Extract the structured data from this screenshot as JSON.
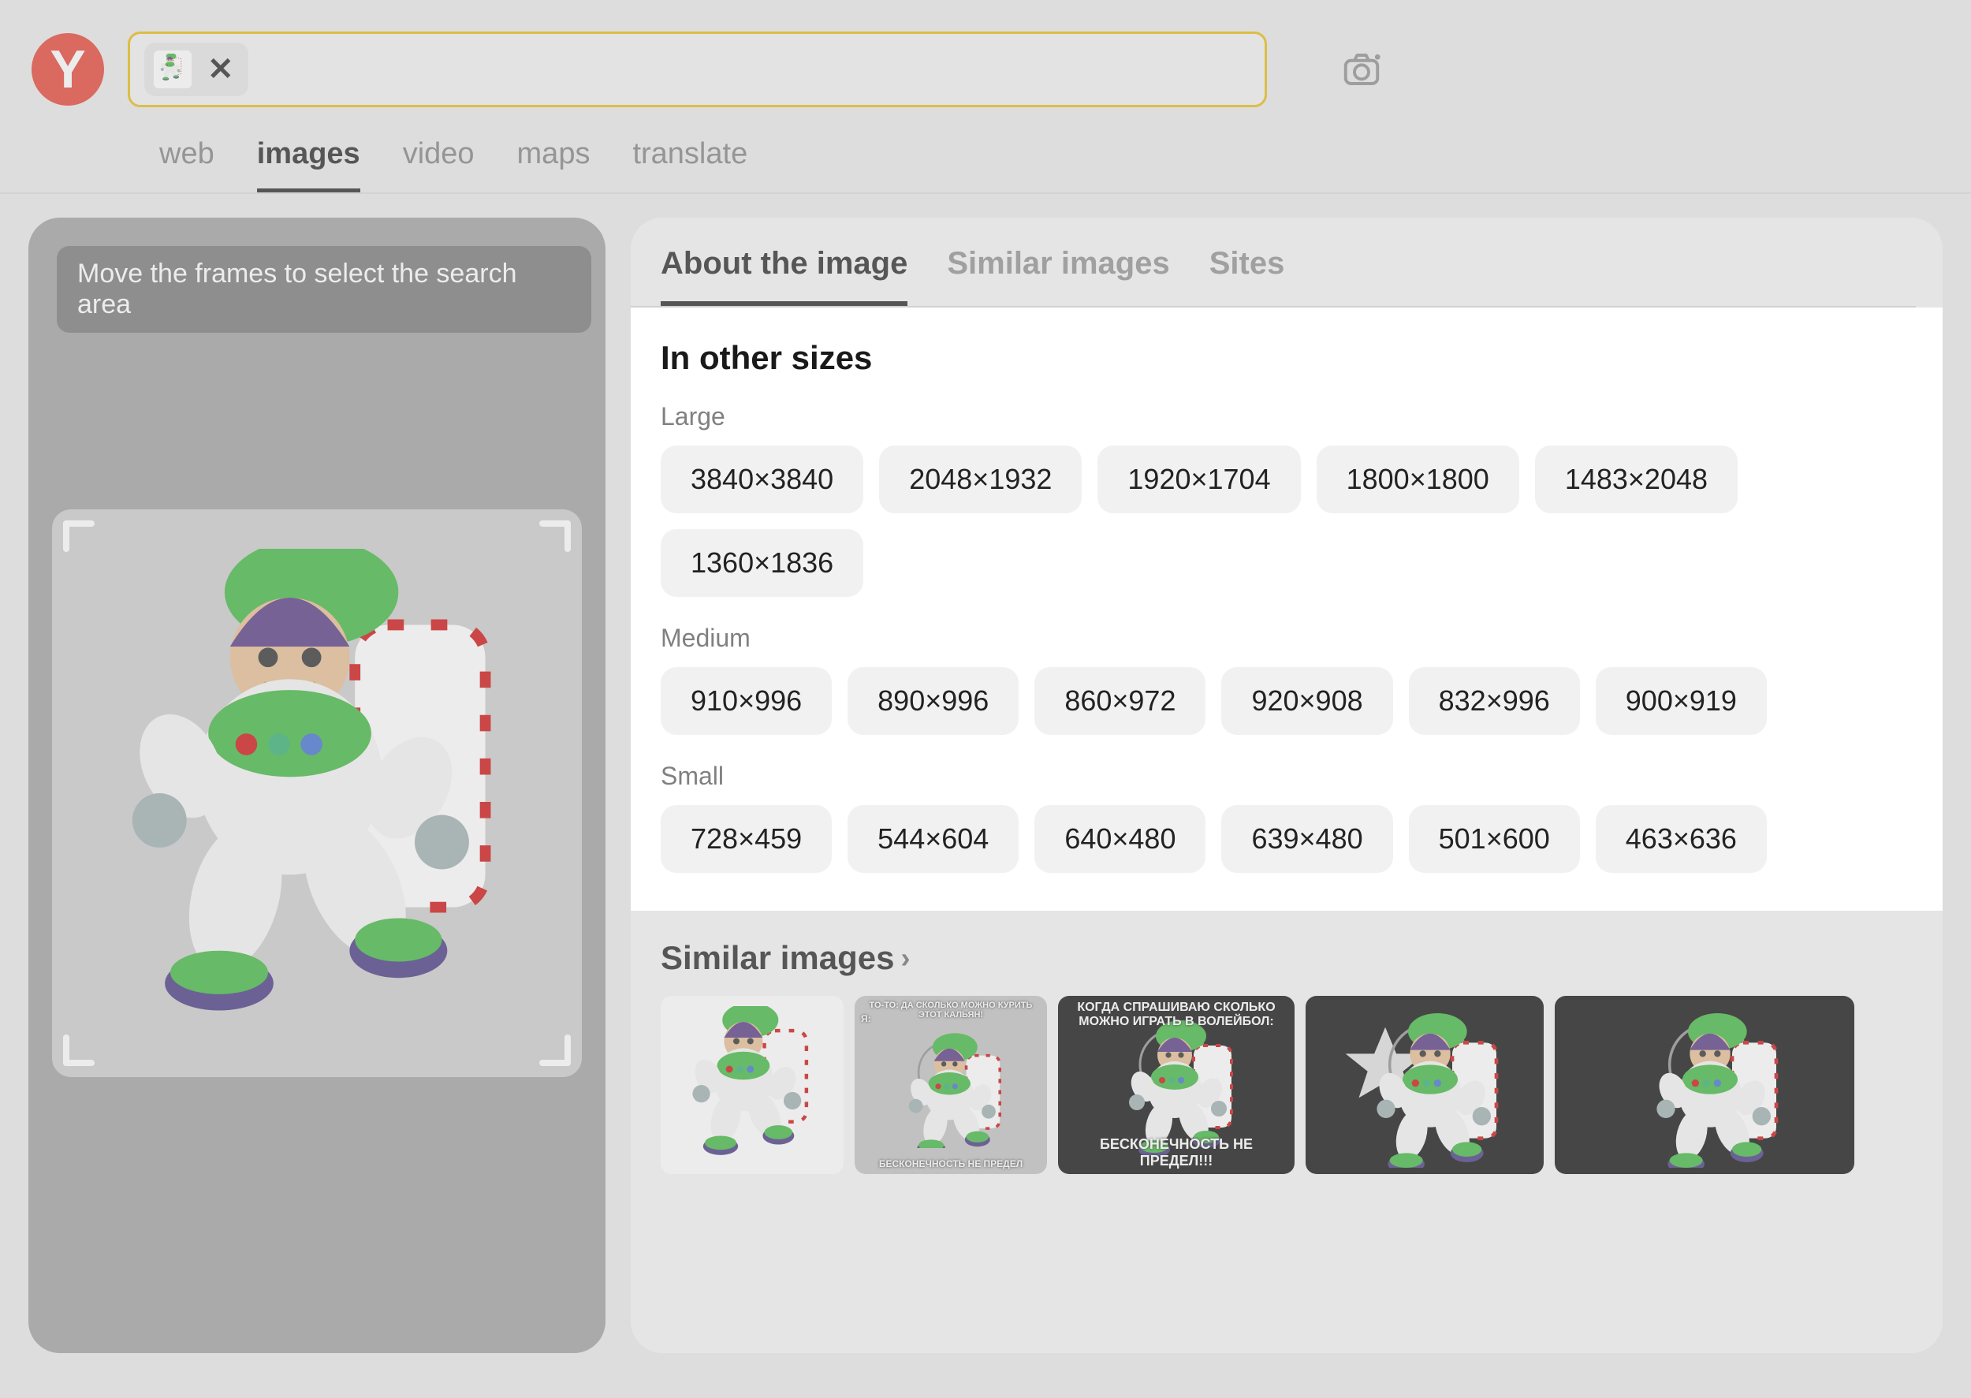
{
  "header": {
    "logo_letter": "Y"
  },
  "nav": {
    "tabs": [
      "web",
      "images",
      "video",
      "maps",
      "translate"
    ],
    "active": "images"
  },
  "left": {
    "hint": "Move the frames to select the search area"
  },
  "subtabs": {
    "items": [
      "About the image",
      "Similar images",
      "Sites"
    ],
    "active": "About the image"
  },
  "sizes": {
    "title": "In other sizes",
    "groups": [
      {
        "label": "Large",
        "items": [
          "3840×3840",
          "2048×1932",
          "1920×1704",
          "1800×1800",
          "1483×2048",
          "1360×1836"
        ]
      },
      {
        "label": "Medium",
        "items": [
          "910×996",
          "890×996",
          "860×972",
          "920×908",
          "832×996",
          "900×919"
        ]
      },
      {
        "label": "Small",
        "items": [
          "728×459",
          "544×604",
          "640×480",
          "639×480",
          "501×600",
          "463×636"
        ]
      }
    ]
  },
  "similar": {
    "title": "Similar images",
    "thumb_captions": {
      "meme1_top": "ТО-ТО: ДА СКОЛЬКО МОЖНО КУРИТЬ ЭТОТ КАЛЬЯН!",
      "meme1_mid": "Я:",
      "meme1_bottom": "БЕСКОНЕЧНОСТЬ НЕ ПРЕДЕЛ",
      "meme2_top": "КОГДА СПРАШИВАЮ СКОЛЬКО МОЖНО ИГРАТЬ В ВОЛЕЙБОЛ:",
      "meme2_bottom": "БЕСКОНЕЧНОСТЬ НЕ ПРЕДЕЛ!!!"
    }
  }
}
